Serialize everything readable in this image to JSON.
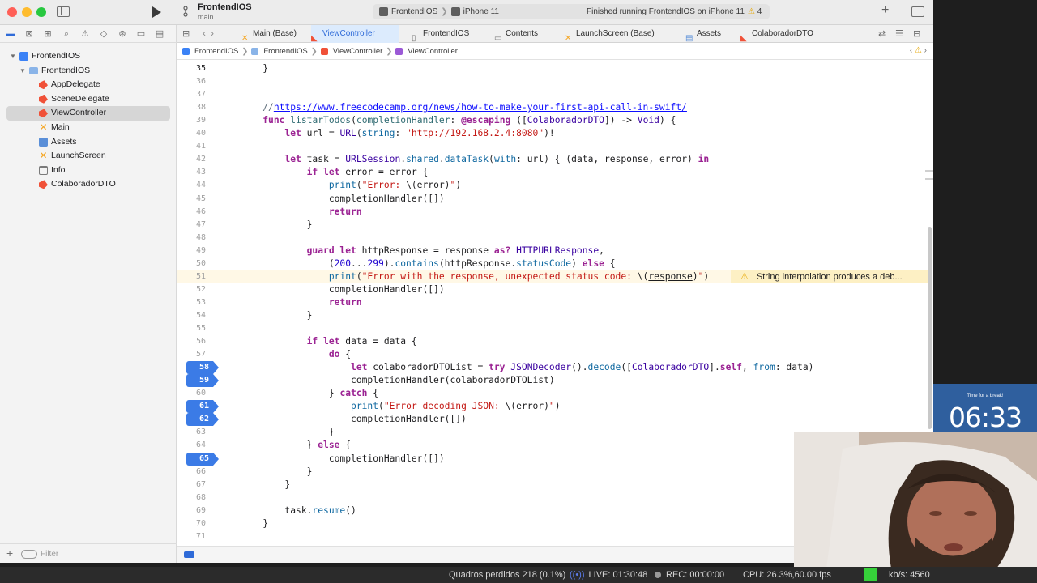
{
  "toolbar": {
    "scheme_name": "FrontendIOS",
    "scheme_branch": "main",
    "run_destination": [
      "FrontendIOS",
      "iPhone 11"
    ],
    "activity_status": "Finished running FrontendIOS on iPhone 11",
    "warning_count": "4"
  },
  "navigator": {
    "items": [
      {
        "label": "FrontendIOS",
        "kind": "project",
        "depth": 0
      },
      {
        "label": "FrontendIOS",
        "kind": "folder",
        "depth": 1
      },
      {
        "label": "AppDelegate",
        "kind": "swift",
        "depth": 2
      },
      {
        "label": "SceneDelegate",
        "kind": "swift",
        "depth": 2
      },
      {
        "label": "ViewController",
        "kind": "swift",
        "depth": 2,
        "selected": true
      },
      {
        "label": "Main",
        "kind": "storyboard",
        "depth": 2
      },
      {
        "label": "Assets",
        "kind": "assets",
        "depth": 2
      },
      {
        "label": "LaunchScreen",
        "kind": "storyboard",
        "depth": 2
      },
      {
        "label": "Info",
        "kind": "plist",
        "depth": 2
      },
      {
        "label": "ColaboradorDTO",
        "kind": "swift",
        "depth": 2
      }
    ],
    "filter_placeholder": "Filter"
  },
  "tabs": [
    {
      "label": "Main (Base)",
      "icon": "storyboard-icon"
    },
    {
      "label": "ViewController",
      "icon": "swift-icon",
      "active": true
    },
    {
      "label": "FrontendIOS",
      "icon": "scheme-icon"
    },
    {
      "label": "Contents",
      "icon": "file-icon"
    },
    {
      "label": "LaunchScreen (Base)",
      "icon": "storyboard-icon"
    },
    {
      "label": "Assets",
      "icon": "assets-icon"
    },
    {
      "label": "ColaboradorDTO",
      "icon": "swift-icon"
    }
  ],
  "breadcrumb": [
    "FrontendIOS",
    "FrontendIOS",
    "ViewController",
    "ViewController"
  ],
  "code": {
    "lines": [
      {
        "n": "35",
        "html": "    }",
        "current": true
      },
      {
        "n": "36",
        "html": ""
      },
      {
        "n": "37",
        "html": ""
      },
      {
        "n": "38",
        "html": "    <span class='c'>//</span><span class='cu'>https://www.freecodecamp.org/news/how-to-make-your-first-api-call-in-swift/</span>"
      },
      {
        "n": "39",
        "html": "    <span class='k'>func</span> <span class='f'>listarTodos</span>(<span class='f'>completionHandler</span>: <span class='k'>@escaping</span> ([<span class='t'>ColaboradorDTO</span>]) -> <span class='t'>Void</span>) {"
      },
      {
        "n": "40",
        "html": "        <span class='k'>let</span> url = <span class='t'>URL</span>(<span class='v'>string</span>: <span class='s'>\"http://192.168.2.4:8080\"</span>)!"
      },
      {
        "n": "41",
        "html": ""
      },
      {
        "n": "42",
        "html": "        <span class='k'>let</span> task = <span class='t'>URLSession</span>.<span class='v'>shared</span>.<span class='v'>dataTask</span>(<span class='v'>with</span>: url) { (data, response, error) <span class='k'>in</span>"
      },
      {
        "n": "43",
        "html": "            <span class='k'>if let</span> error = error {"
      },
      {
        "n": "44",
        "html": "                <span class='v'>print</span>(<span class='s'>\"Error: </span>\\(error)<span class='s'>\"</span>)"
      },
      {
        "n": "45",
        "html": "                completionHandler([])"
      },
      {
        "n": "46",
        "html": "                <span class='k'>return</span>"
      },
      {
        "n": "47",
        "html": "            }"
      },
      {
        "n": "48",
        "html": ""
      },
      {
        "n": "49",
        "html": "            <span class='k'>guard let</span> httpResponse = response <span class='k'>as?</span> <span class='t'>HTTPURLResponse</span>,"
      },
      {
        "n": "50",
        "html": "                (<span class='n'>200</span>...<span class='n'>299</span>).<span class='v'>contains</span>(httpResponse.<span class='v'>statusCode</span>) <span class='k'>else</span> {"
      },
      {
        "n": "51",
        "html": "                <span class='v'>print</span>(<span class='s'>\"Error with the response, unexpected status code: </span>\\(<u>response</u>)<span class='s'>\"</span>)",
        "warning": "String interpolation produces a deb..."
      },
      {
        "n": "52",
        "html": "                completionHandler([])"
      },
      {
        "n": "53",
        "html": "                <span class='k'>return</span>"
      },
      {
        "n": "54",
        "html": "            }"
      },
      {
        "n": "55",
        "html": ""
      },
      {
        "n": "56",
        "html": "            <span class='k'>if let</span> data = data {"
      },
      {
        "n": "57",
        "html": "                <span class='k'>do</span> {"
      },
      {
        "n": "58",
        "html": "                    <span class='k'>let</span> colaboradorDTOList = <span class='k'>try</span> <span class='t'>JSONDecoder</span>().<span class='v'>decode</span>([<span class='t'>ColaboradorDTO</span>].<span class='k'>self</span>, <span class='v'>from</span>: data)",
        "breakpoint": true
      },
      {
        "n": "59",
        "html": "                    completionHandler(colaboradorDTOList)",
        "breakpoint": true
      },
      {
        "n": "60",
        "html": "                } <span class='k'>catch</span> {"
      },
      {
        "n": "61",
        "html": "                    <span class='v'>print</span>(<span class='s'>\"Error decoding JSON: </span>\\(error)<span class='s'>\"</span>)",
        "breakpoint": true
      },
      {
        "n": "62",
        "html": "                    completionHandler([])",
        "breakpoint": true
      },
      {
        "n": "63",
        "html": "                }"
      },
      {
        "n": "64",
        "html": "            } <span class='k'>else</span> {"
      },
      {
        "n": "65",
        "html": "                completionHandler([])",
        "breakpoint": true
      },
      {
        "n": "66",
        "html": "            }"
      },
      {
        "n": "67",
        "html": "        }"
      },
      {
        "n": "68",
        "html": ""
      },
      {
        "n": "69",
        "html": "        task.<span class='v'>resume</span>()"
      },
      {
        "n": "70",
        "html": "    }"
      },
      {
        "n": "71",
        "html": ""
      }
    ]
  },
  "timer": {
    "caption": "Time for a break!",
    "value": "06:33"
  },
  "stream_status": {
    "dropped_frames": "Quadros perdidos 218 (0.1%)",
    "live": "LIVE: 01:30:48",
    "rec": "REC: 00:00:00",
    "cpu": "CPU: 26.3%,60.00 fps",
    "bitrate": "kb/s: 4560"
  },
  "colors": {
    "accent": "#2f6bd8",
    "breakpoint": "#3b7be6",
    "warning": "#e7a700",
    "keyword": "#9b2393",
    "string": "#c41a16"
  }
}
